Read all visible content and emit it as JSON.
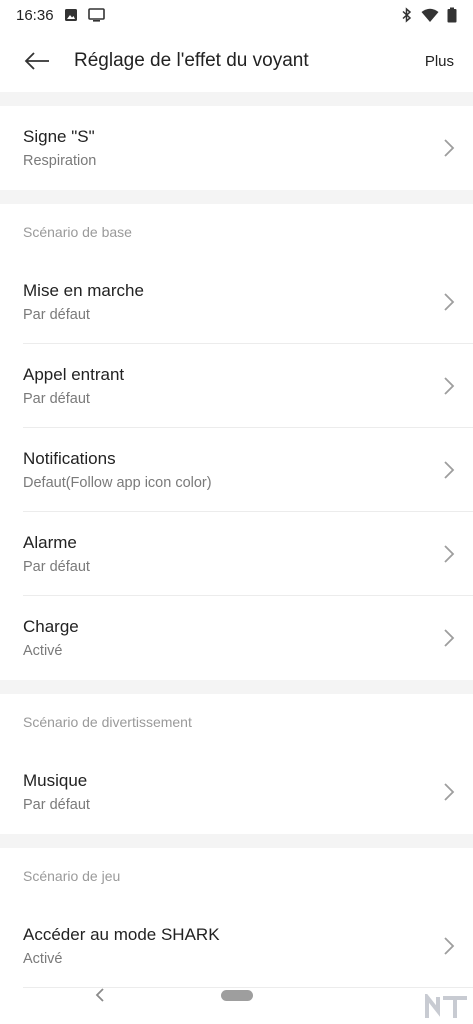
{
  "status": {
    "time": "16:36"
  },
  "header": {
    "title": "Réglage de l'effet du voyant",
    "more_label": "Plus"
  },
  "top_item": {
    "title": "Signe \"S\"",
    "subtitle": "Respiration"
  },
  "sections": [
    {
      "label": "Scénario de base",
      "items": [
        {
          "title": "Mise en marche",
          "subtitle": "Par défaut"
        },
        {
          "title": "Appel entrant",
          "subtitle": "Par défaut"
        },
        {
          "title": "Notifications",
          "subtitle": "Defaut(Follow app icon color)"
        },
        {
          "title": "Alarme",
          "subtitle": "Par défaut"
        },
        {
          "title": "Charge",
          "subtitle": "Activé"
        }
      ]
    },
    {
      "label": "Scénario de divertissement",
      "items": [
        {
          "title": "Musique",
          "subtitle": "Par défaut"
        }
      ]
    },
    {
      "label": "Scénario de jeu",
      "items": [
        {
          "title": "Accéder au mode SHARK",
          "subtitle": "Activé"
        }
      ]
    }
  ],
  "colors": {
    "gap": "#f4f4f4",
    "section_label": "#9a9a9a",
    "subtitle": "#7a7a7a",
    "chevron": "#9e9e9e"
  },
  "icons": {
    "status_left": [
      "image-icon",
      "cast-screen-icon"
    ],
    "status_right": [
      "bluetooth-icon",
      "wifi-icon",
      "battery-icon"
    ],
    "header": "arrow-back-icon",
    "row": "chevron-right-icon",
    "nav": [
      "nav-back-icon",
      "home-pill"
    ],
    "watermark": "nt-logo"
  }
}
